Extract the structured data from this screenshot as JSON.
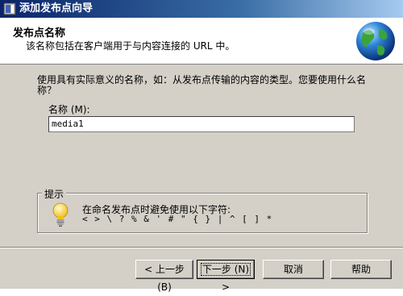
{
  "window": {
    "title": "添加发布点向导"
  },
  "header": {
    "title": "发布点名称",
    "subtitle": "该名称包括在客户端用于与内容连接的 URL 中。"
  },
  "body": {
    "question": "使用具有实际意义的名称，如：从发布点传输的内容的类型。您要使用什么名称？",
    "name_label": "名称 (M):",
    "name_value": "media1"
  },
  "hint": {
    "caption": "提示",
    "line1": "在命名发布点时避免使用以下字符:",
    "line2": "< > \\ ? % & ' # \" { } | ^ [ ] *"
  },
  "buttons": {
    "back": "< 上一步 (B)",
    "next": "下一步 (N) >",
    "cancel": "取消",
    "help": "帮助"
  },
  "colors": {
    "title_bar_start": "#0a246a",
    "dialog_bg": "#d4d0c8"
  },
  "icons": {
    "app": "wizard-app-icon",
    "header": "globe-icon",
    "hint": "lightbulb-icon"
  }
}
